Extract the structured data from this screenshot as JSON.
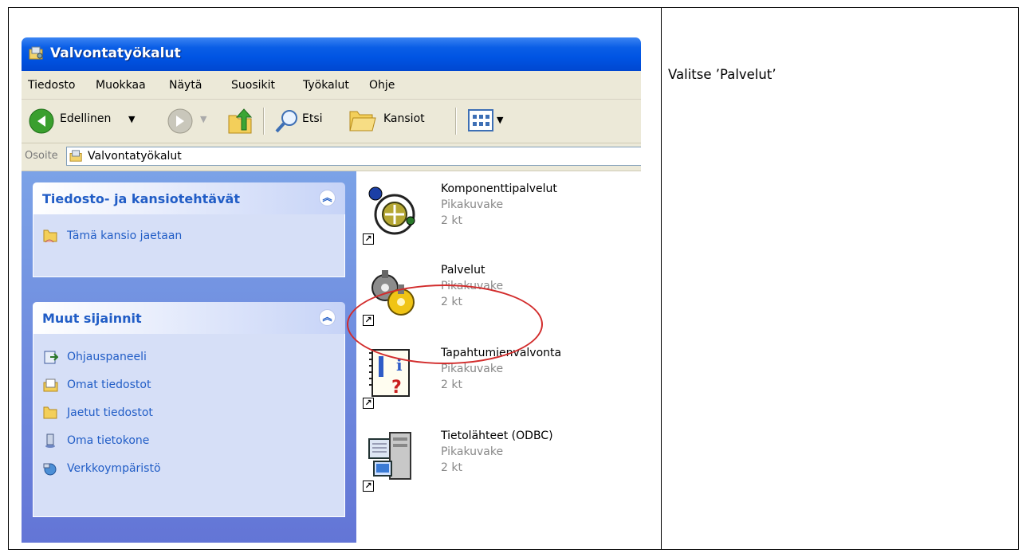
{
  "instruction": "Valitse ’Palvelut’",
  "window": {
    "title": "Valvontatyökalut",
    "menu": [
      "Tiedosto",
      "Muokkaa",
      "Näytä",
      "Suosikit",
      "Työkalut",
      "Ohje"
    ],
    "toolbar": {
      "back_label": "Edellinen",
      "search_label": "Etsi",
      "folders_label": "Kansiot"
    },
    "address": {
      "label": "Osoite",
      "value": "Valvontatyökalut"
    }
  },
  "sidebar": {
    "tasks_panel": {
      "title": "Tiedosto- ja kansiotehtävät",
      "items": [
        {
          "label": "Tämä kansio jaetaan",
          "icon": "share-folder-icon"
        }
      ]
    },
    "other_places_panel": {
      "title": "Muut sijainnit",
      "items": [
        {
          "label": "Ohjauspaneeli",
          "icon": "control-panel-icon"
        },
        {
          "label": "Omat tiedostot",
          "icon": "my-documents-icon"
        },
        {
          "label": "Jaetut tiedostot",
          "icon": "shared-documents-icon"
        },
        {
          "label": "Oma tietokone",
          "icon": "my-computer-icon"
        },
        {
          "label": "Verkkoympäristö",
          "icon": "network-places-icon"
        }
      ]
    }
  },
  "files": [
    {
      "name": "Komponenttipalvelut",
      "type": "Pikakuvake",
      "size": "2 kt",
      "icon": "component-services-icon"
    },
    {
      "name": "Palvelut",
      "type": "Pikakuvake",
      "size": "2 kt",
      "icon": "services-gears-icon",
      "highlighted": true
    },
    {
      "name": "Tapahtumienvalvonta",
      "type": "Pikakuvake",
      "size": "2 kt",
      "icon": "event-viewer-icon"
    },
    {
      "name": "Tietolähteet (ODBC)",
      "type": "Pikakuvake",
      "size": "2 kt",
      "icon": "odbc-data-sources-icon"
    }
  ],
  "colors": {
    "titlebar": "#0054e3",
    "sidebar": "#6f8fe0",
    "link": "#215dc6",
    "highlight_circle": "#d22c2c"
  }
}
